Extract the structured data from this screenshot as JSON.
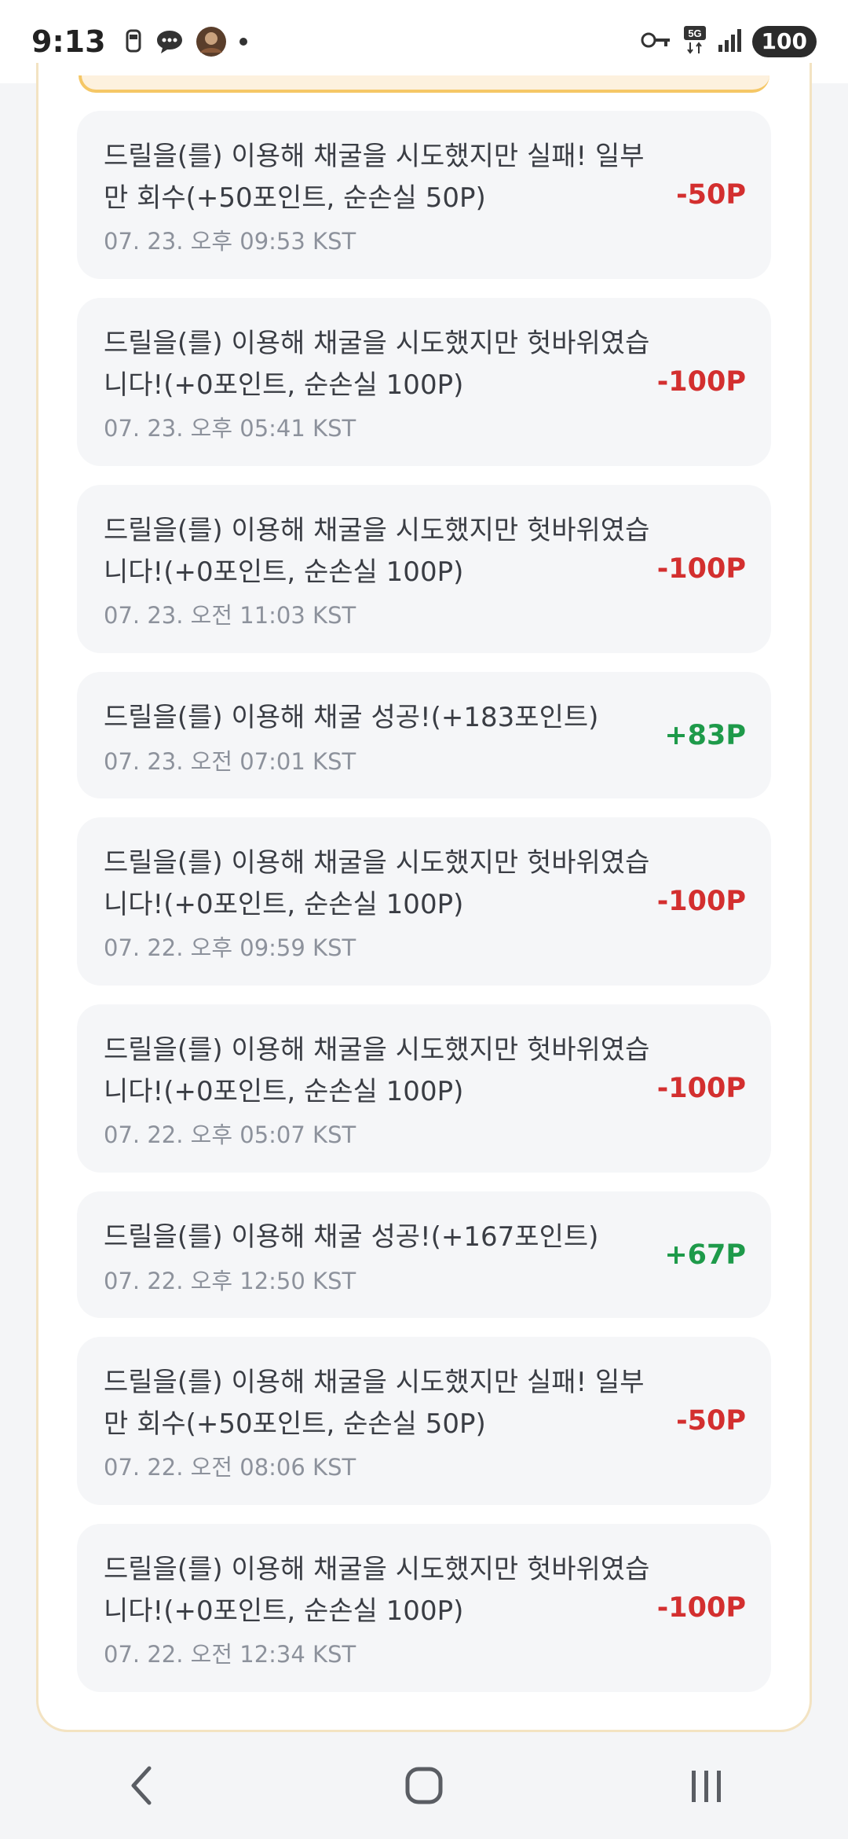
{
  "status_bar": {
    "time": "9:13",
    "battery": "100",
    "network": "5G"
  },
  "transactions": [
    {
      "description": "드릴을(를) 이용해 채굴을 시도했지만 실패! 일부만 회수(+50포인트, 순손실 50P)",
      "time": "07. 23. 오후 09:53 KST",
      "amount": "-50P",
      "type": "negative"
    },
    {
      "description": "드릴을(를) 이용해 채굴을 시도했지만 헛바위였습니다!(+0포인트, 순손실 100P)",
      "time": "07. 23. 오후 05:41 KST",
      "amount": "-100P",
      "type": "negative"
    },
    {
      "description": "드릴을(를) 이용해 채굴을 시도했지만 헛바위였습니다!(+0포인트, 순손실 100P)",
      "time": "07. 23. 오전 11:03 KST",
      "amount": "-100P",
      "type": "negative"
    },
    {
      "description": "드릴을(를) 이용해 채굴 성공!(+183포인트)",
      "time": "07. 23. 오전 07:01 KST",
      "amount": "+83P",
      "type": "positive"
    },
    {
      "description": "드릴을(를) 이용해 채굴을 시도했지만 헛바위였습니다!(+0포인트, 순손실 100P)",
      "time": "07. 22. 오후 09:59 KST",
      "amount": "-100P",
      "type": "negative"
    },
    {
      "description": "드릴을(를) 이용해 채굴을 시도했지만 헛바위였습니다!(+0포인트, 순손실 100P)",
      "time": "07. 22. 오후 05:07 KST",
      "amount": "-100P",
      "type": "negative"
    },
    {
      "description": "드릴을(를) 이용해 채굴 성공!(+167포인트)",
      "time": "07. 22. 오후 12:50 KST",
      "amount": "+67P",
      "type": "positive"
    },
    {
      "description": "드릴을(를) 이용해 채굴을 시도했지만 실패! 일부만 회수(+50포인트, 순손실 50P)",
      "time": "07. 22. 오전 08:06 KST",
      "amount": "-50P",
      "type": "negative"
    },
    {
      "description": "드릴을(를) 이용해 채굴을 시도했지만 헛바위였습니다!(+0포인트, 순손실 100P)",
      "time": "07. 22. 오전 12:34 KST",
      "amount": "-100P",
      "type": "negative"
    }
  ],
  "colors": {
    "negative": "#d32f2f",
    "positive": "#1e9a4a",
    "card_bg": "#f5f6f8"
  },
  "icons": {
    "status_left": [
      "car-icon",
      "chat-bubble-icon",
      "avatar-icon",
      "dot-icon"
    ],
    "status_right": [
      "key-icon",
      "5g-icon",
      "signal-icon",
      "battery-badge"
    ],
    "nav": [
      "back-icon",
      "home-icon",
      "recents-icon"
    ]
  }
}
